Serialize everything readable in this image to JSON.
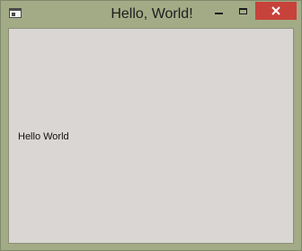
{
  "window": {
    "title": "Hello, World!",
    "frame_color": "#a3ab86",
    "close_color": "#c7423a"
  },
  "icons": {
    "app": "app-window-icon",
    "minimize": "minimize-icon",
    "maximize": "maximize-icon",
    "close": "close-icon"
  },
  "content": {
    "label": "Hello World",
    "background": "#dad6d3"
  }
}
